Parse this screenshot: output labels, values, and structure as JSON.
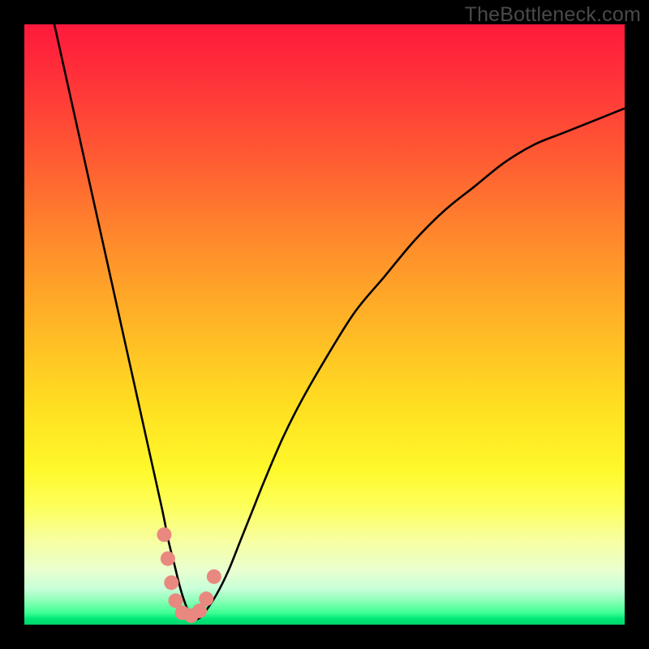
{
  "watermark": "TheBottleneck.com",
  "chart_data": {
    "type": "line",
    "title": "",
    "xlabel": "",
    "ylabel": "",
    "xlim": [
      0,
      100
    ],
    "ylim": [
      0,
      100
    ],
    "grid": false,
    "legend": false,
    "background": "rainbow-vertical-gradient",
    "series": [
      {
        "name": "bottleneck-curve",
        "color": "#000000",
        "x": [
          5,
          7,
          9,
          11,
          13,
          15,
          17,
          19,
          21,
          23,
          24,
          25,
          26,
          27,
          28,
          29,
          30,
          32,
          34,
          36,
          38,
          40,
          43,
          46,
          50,
          55,
          60,
          65,
          70,
          75,
          80,
          85,
          90,
          95,
          100
        ],
        "y": [
          100,
          91,
          82,
          73,
          64,
          55,
          46,
          37,
          28,
          19,
          14,
          10,
          6,
          3,
          1,
          1,
          2,
          5,
          9,
          14,
          19,
          24,
          31,
          37,
          44,
          52,
          58,
          64,
          69,
          73,
          77,
          80,
          82,
          84,
          86
        ]
      }
    ],
    "markers": [
      {
        "name": "highlight-dots",
        "color": "#e9887f",
        "points": [
          {
            "x": 23.3,
            "y": 15
          },
          {
            "x": 23.9,
            "y": 11
          },
          {
            "x": 24.5,
            "y": 7
          },
          {
            "x": 25.2,
            "y": 4
          },
          {
            "x": 26.3,
            "y": 2
          },
          {
            "x": 27.8,
            "y": 1.5
          },
          {
            "x": 29.2,
            "y": 2.3
          },
          {
            "x": 30.3,
            "y": 4.3
          },
          {
            "x": 31.6,
            "y": 8
          }
        ]
      }
    ]
  }
}
